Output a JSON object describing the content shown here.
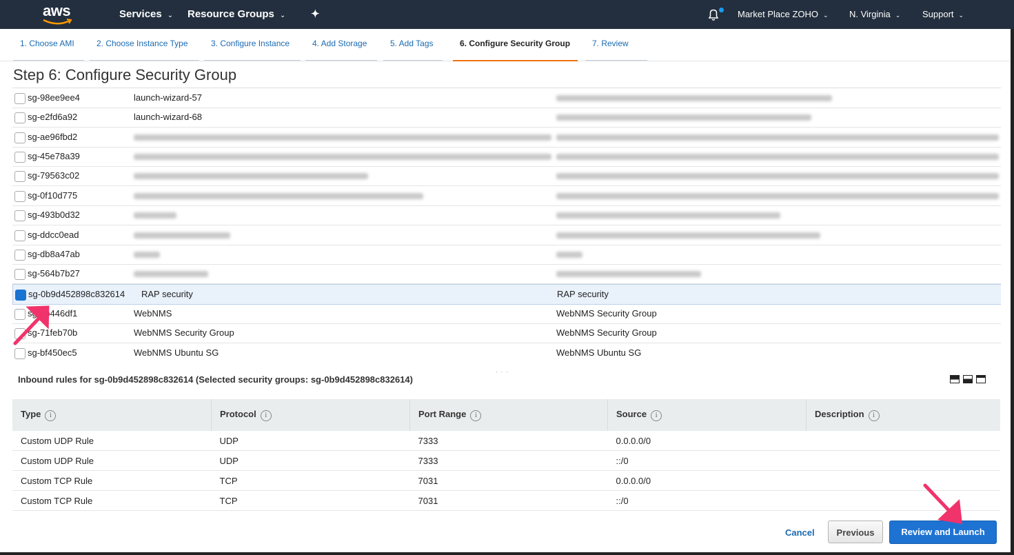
{
  "topbar": {
    "logo_text": "aws",
    "services": "Services",
    "resource_groups": "Resource Groups",
    "account": "Market Place ZOHO",
    "region": "N. Virginia",
    "support": "Support",
    "caret": "⌄",
    "pin_icon": "✦"
  },
  "steps": [
    {
      "label": "1. Choose AMI"
    },
    {
      "label": "2. Choose Instance Type"
    },
    {
      "label": "3. Configure Instance"
    },
    {
      "label": "4. Add Storage"
    },
    {
      "label": "5. Add Tags"
    },
    {
      "label": "6. Configure Security Group",
      "active": true
    },
    {
      "label": "7. Review"
    }
  ],
  "page_title": "Step 6: Configure Security Group",
  "security_groups": [
    {
      "id": "sg-98ee9ee4",
      "name": "launch-wizard-57",
      "description": ""
    },
    {
      "id": "sg-e2fd6a92",
      "name": "launch-wizard-68",
      "description": ""
    },
    {
      "id": "sg-ae96fbd2",
      "name": "",
      "description": ""
    },
    {
      "id": "sg-45e78a39",
      "name": "",
      "description": ""
    },
    {
      "id": "sg-79563c02",
      "name": "",
      "description": ""
    },
    {
      "id": "sg-0f10d775",
      "name": "",
      "description": ""
    },
    {
      "id": "sg-493b0d32",
      "name": "",
      "description": ""
    },
    {
      "id": "sg-ddcc0ead",
      "name": "",
      "description": ""
    },
    {
      "id": "sg-db8a47ab",
      "name": "",
      "description": ""
    },
    {
      "id": "sg-564b7b27",
      "name": "",
      "description": ""
    },
    {
      "id": "sg-0b9d452898c832614",
      "name": "RAP security",
      "description": "RAP security",
      "selected": true
    },
    {
      "id": "sg-5b446df1",
      "name": "WebNMS",
      "description": "WebNMS Security Group"
    },
    {
      "id": "sg-71feb70b",
      "name": "WebNMS Security Group",
      "description": "WebNMS Security Group"
    },
    {
      "id": "sg-bf450ec5",
      "name": "WebNMS Ubuntu SG",
      "description": "WebNMS Ubuntu SG"
    }
  ],
  "inbound": {
    "title": "Inbound rules for sg-0b9d452898c832614 (Selected security groups: sg-0b9d452898c832614)",
    "columns": [
      "Type",
      "Protocol",
      "Port Range",
      "Source",
      "Description"
    ],
    "info_glyph": "i",
    "rows": [
      [
        "Custom UDP Rule",
        "UDP",
        "7333",
        "0.0.0.0/0",
        ""
      ],
      [
        "Custom UDP Rule",
        "UDP",
        "7333",
        "::/0",
        ""
      ],
      [
        "Custom TCP Rule",
        "TCP",
        "7031",
        "0.0.0.0/0",
        ""
      ],
      [
        "Custom TCP Rule",
        "TCP",
        "7031",
        "::/0",
        ""
      ]
    ]
  },
  "footer": {
    "cancel": "Cancel",
    "previous": "Previous",
    "review_launch": "Review and Launch"
  },
  "colors": {
    "topbar": "#232f3e",
    "link": "#1a6ab1",
    "accent_tab": "#ec7211",
    "primary_button": "#1e73d2",
    "annotation_arrow": "#f0336b"
  }
}
